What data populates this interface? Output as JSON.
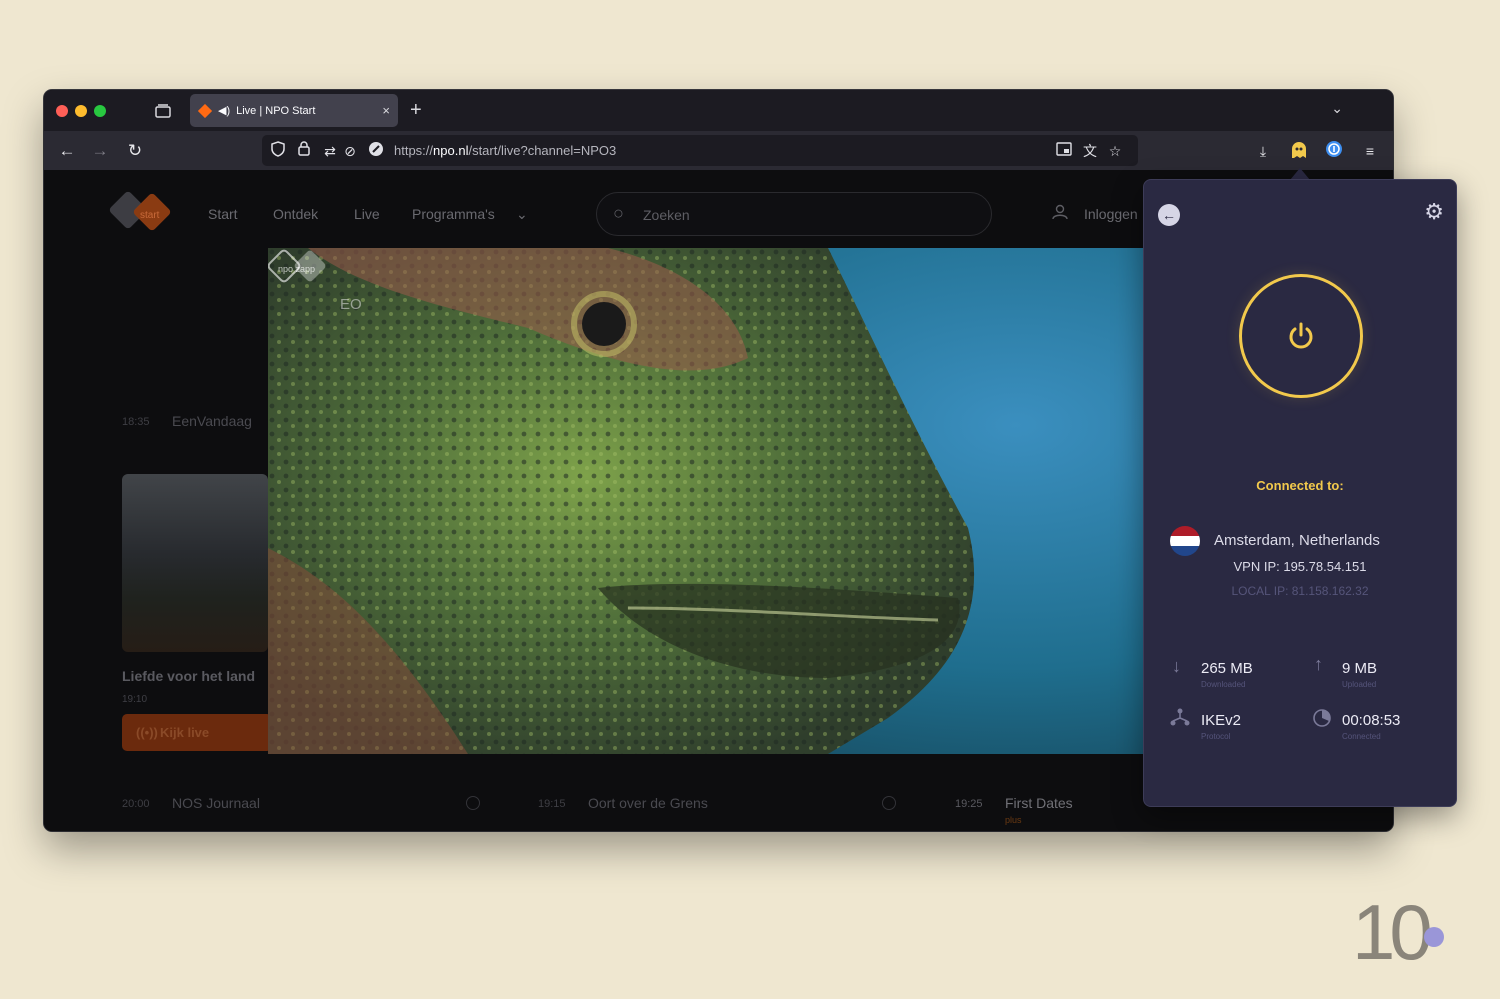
{
  "browser": {
    "tab": {
      "title": "Live | NPO Start",
      "close": "×"
    },
    "new_tab": "+",
    "url": {
      "scheme_host_prefix": "https://",
      "host": "npo.nl",
      "path": "/start/live?channel=NPO3"
    }
  },
  "npo": {
    "logo_text": "start",
    "nav": [
      "Start",
      "Ontdek",
      "Live",
      "Programma's"
    ],
    "search_placeholder": "Zoeken",
    "login": "Inloggen",
    "schedule_top": {
      "time": "18:35",
      "title": "EenVandaag"
    },
    "card": {
      "title": "Liefde voor het land",
      "time": "19:10",
      "button": "Kijk live"
    },
    "schedule_bottom": [
      {
        "time": "20:00",
        "title": "NOS Journaal"
      },
      {
        "time": "19:15",
        "title": "Oort over de Grens"
      },
      {
        "time": "19:25",
        "title": "First Dates",
        "sub": "plus"
      }
    ],
    "video": {
      "channel_logo": "EO",
      "watermark": "npo zapp"
    }
  },
  "vpn": {
    "connected_label": "Connected to:",
    "location": "Amsterdam, Netherlands",
    "vpn_ip": "VPN IP: 195.78.54.151",
    "local_ip": "LOCAL IP: 81.158.162.32",
    "downloaded": {
      "value": "265 MB",
      "label": "Downloaded"
    },
    "uploaded": {
      "value": "9 MB",
      "label": "Uploaded"
    },
    "protocol": {
      "value": "IKEv2",
      "label": "Protocol"
    },
    "connected_time": {
      "value": "00:08:53",
      "label": "Connected"
    },
    "accent": "#f2c94c"
  },
  "brand": {
    "text": "10"
  }
}
